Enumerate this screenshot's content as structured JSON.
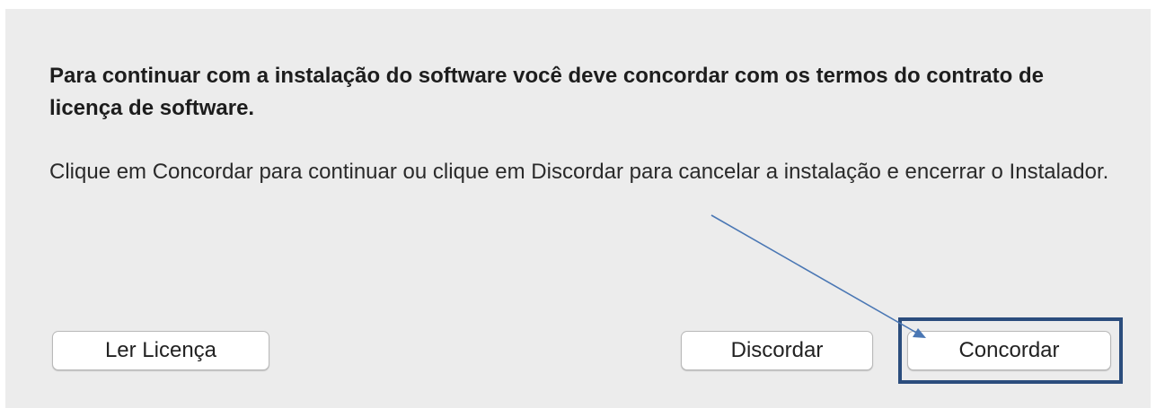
{
  "dialog": {
    "heading": "Para continuar com a instalação do software você deve concordar com os termos do contrato de licença de software.",
    "body": "Clique em Concordar para continuar ou clique em Discordar para cancelar a instalação e encerrar o Instalador."
  },
  "buttons": {
    "read_license": "Ler Licença",
    "disagree": "Discordar",
    "agree": "Concordar"
  },
  "annotation": {
    "color": "#2b4d7d",
    "arrow_color": "#4a77b4"
  }
}
